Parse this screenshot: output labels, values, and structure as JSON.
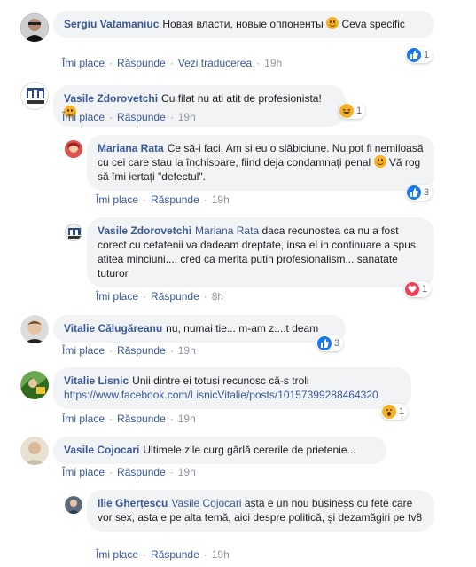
{
  "action_labels": {
    "like": "Îmi place",
    "reply": "Răspunde",
    "translate": "Vezi traducerea"
  },
  "comments": [
    {
      "author": "Sergiu Vatamaniuc",
      "text": "Новая власти, новые оппоненты",
      "text2": "Ceva specific",
      "time": "19h",
      "reactions": {
        "icon": "like",
        "count": "1"
      }
    },
    {
      "author": "Vasile Zdorovetchi",
      "text": "Cu filat nu ati atit de profesionista!",
      "time": "19h",
      "reactions": {
        "icon": "laugh",
        "count": "1"
      }
    },
    {
      "author": "Mariana Rata",
      "text": "Ce să-i faci. Am si eu o slăbiciune. Nu pot fi nemiloasă cu cei care stau la închisoare, fiind deja condamnați penal",
      "text2": "Vă rog să îmi iertați \"defectul\".",
      "time": "19h",
      "reactions": {
        "icon": "like",
        "count": "3"
      }
    },
    {
      "author": "Vasile Zdorovetchi",
      "mention": "Mariana Rata",
      "text": "daca recunostea ca nu a fost corect cu cetatenii va dadeam dreptate, insa el in continuare a spus atitea minciuni.... cred ca merita putin profesionalism... sanatate tuturor",
      "time": "8h",
      "reactions": {
        "icon": "love",
        "count": "1"
      }
    },
    {
      "author": "Vitalie Călugăreanu",
      "text": "nu, numai tie... m-am z....t deam",
      "time": "19h",
      "reactions": {
        "icon": "like",
        "count": "3"
      }
    },
    {
      "author": "Vitalie Lisnic",
      "text": "Unii dintre ei totuși recunosc că-s troli",
      "link": "https://www.facebook.com/LisnicVitalie/posts/10157399288464320",
      "time": "19h",
      "reactions": {
        "icon": "wow",
        "count": "1"
      }
    },
    {
      "author": "Vasile Cojocari",
      "text": "Ultimele zile curg gârlă cererile de prietenie...",
      "time": "19h"
    },
    {
      "author": "Ilie Gherțescu",
      "mention": "Vasile Cojocari",
      "text": "asta e un nou business cu fete care vor sex, asta e pe alta temă, aici despre politică, și dezamăgiri pe tv8",
      "time": "19h"
    }
  ],
  "colors": {
    "link": "#385898",
    "bubble": "#f2f3f5",
    "meta": "#90949c",
    "like": "#1877f2",
    "love": "#f33e58"
  }
}
